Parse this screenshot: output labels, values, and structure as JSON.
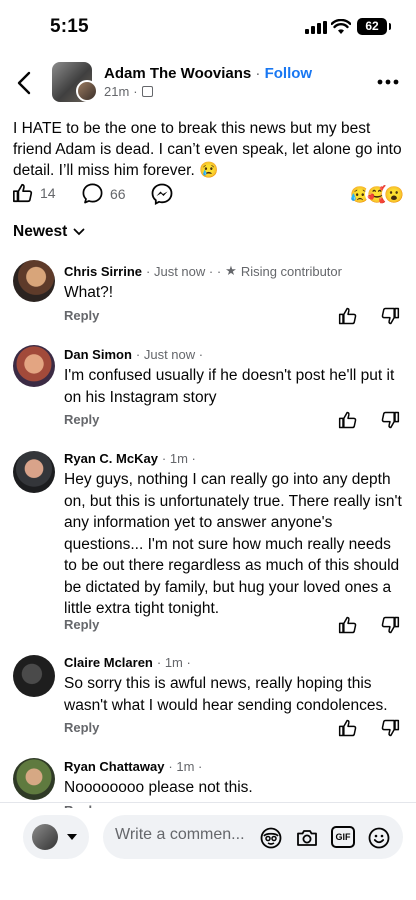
{
  "status_bar": {
    "time": "5:15",
    "battery": "62"
  },
  "header": {
    "author": "Adam The Woovians",
    "separator": "·",
    "follow_label": "Follow",
    "time_ago": "21m",
    "dot": "·"
  },
  "post": {
    "text": "I HATE to be the one to break this news but my best friend Adam is dead. I can’t even speak, let alone go into detail. I’ll miss him forever. 😢",
    "like_count": "14",
    "comment_count": "66",
    "reactions": [
      "😥",
      "🥰",
      "😮"
    ]
  },
  "sort": {
    "label": "Newest"
  },
  "comments": [
    {
      "name": "Chris Sirrine",
      "meta": "· Just now ·  ·",
      "badge": "Rising contributor",
      "text": "What?!",
      "reply_label": "Reply"
    },
    {
      "name": "Dan Simon",
      "meta": "· Just now ·",
      "text": "I'm confused usually if he doesn't post he'll put it on his Instagram story",
      "reply_label": "Reply"
    },
    {
      "name": "Ryan C. McKay",
      "meta": "· 1m ·",
      "text": "Hey guys, nothing I can really go into any depth on, but this is unfortunately true. There really isn't any information yet to answer anyone's questions... I'm not sure how much really needs to be out there regardless as much of this should be dictated by family, but hug your loved ones a little extra tight tonight.",
      "reply_label": "Reply"
    },
    {
      "name": "Claire Mclaren",
      "meta": "· 1m ·",
      "text": "So sorry this is awful news, really hoping this wasn't what I would hear sending condolences.",
      "reply_label": "Reply"
    },
    {
      "name": "Ryan Chattaway",
      "meta": "· 1m ·",
      "text": "Noooooooo please not this.",
      "reply_label": "Reply"
    }
  ],
  "composer": {
    "placeholder": "Write a commen...",
    "gif_label": "GIF"
  }
}
